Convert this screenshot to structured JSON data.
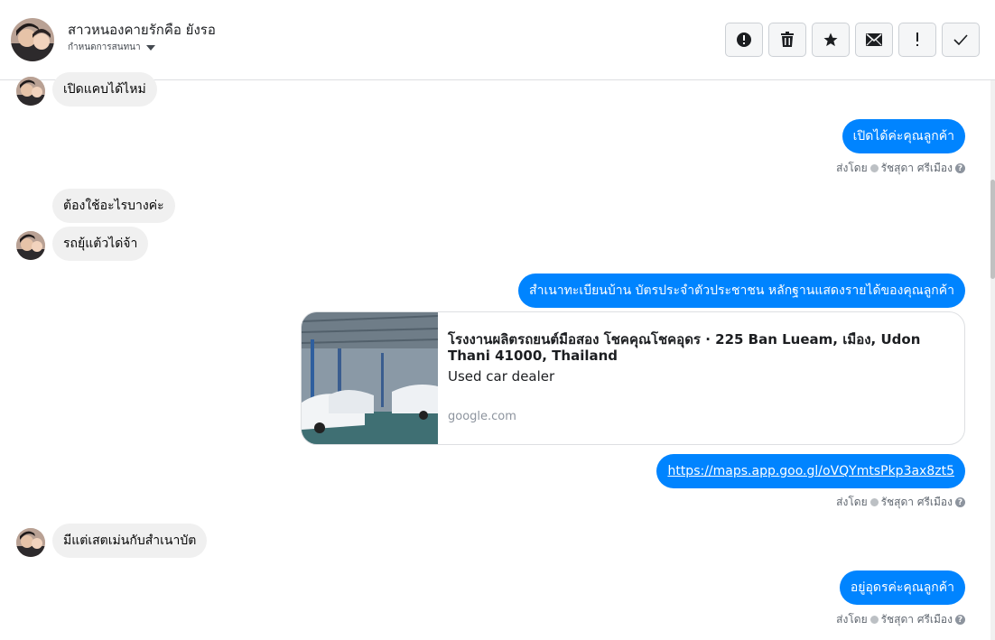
{
  "header": {
    "contact_name": "สาวหนองคายรักคือ ยังรอ",
    "assign_label": "กำหนดการสนทนา",
    "actions": [
      {
        "name": "spam",
        "icon": "alert-circle-icon"
      },
      {
        "name": "delete",
        "icon": "trash-icon"
      },
      {
        "name": "star",
        "icon": "star-icon"
      },
      {
        "name": "mark-unread",
        "icon": "envelope-icon"
      },
      {
        "name": "follow-up",
        "icon": "exclamation-icon"
      },
      {
        "name": "done",
        "icon": "checkmark-icon"
      }
    ]
  },
  "messages": {
    "m1": "เปิดแคบได้ไหม่",
    "m2": "เปิดได้ค่ะคุณลูกค้า",
    "m3": "ต้องใช้อะไรบางค่ะ",
    "m4": "รถยุ้แต้วได่จ้า",
    "m5": "สำเนาทะเบียนบ้าน บัตรประจำตัวประชาชน หลักฐานแสดงรายได้ของคุณลูกค้า",
    "m6": "https://maps.app.goo.gl/oVQYmtsPkp3ax8zt5",
    "m7": "มีแต่เสตเม่นกับสำเนาบัต",
    "m8": "อยู่อุดรค่ะคุณลูกค้า"
  },
  "sent_by": {
    "prefix": "ส่งโดย",
    "agent": "รัชสุดา ศรีเมือง",
    "help": "?"
  },
  "link_card": {
    "title": "โรงงานผลิตรถยนต์มือสอง โชคคุณโชคอุดร · 225 Ban Lueam, เมือง, Udon Thani 41000, Thailand",
    "description": "Used car dealer",
    "domain": "google.com"
  },
  "colors": {
    "outgoing_bubble": "#0084ff",
    "incoming_bubble": "#f0f0f0"
  }
}
